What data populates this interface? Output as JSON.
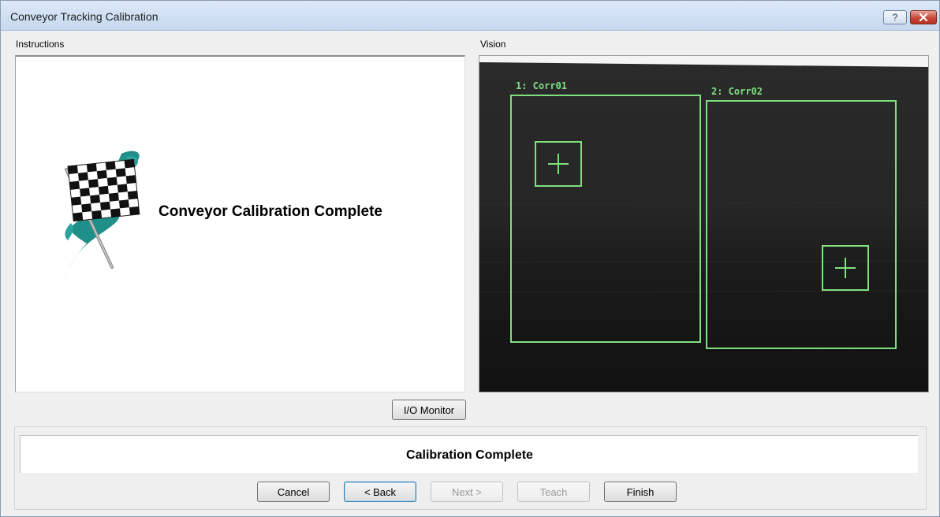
{
  "window": {
    "title": "Conveyor Tracking Calibration",
    "help_label": "?"
  },
  "instructions": {
    "group_label": "Instructions",
    "heading": "Conveyor Calibration Complete"
  },
  "vision": {
    "group_label": "Vision",
    "regions": [
      {
        "label": "1: Corr01"
      },
      {
        "label": "2: Corr02"
      }
    ],
    "overlay_color": "#7fe07f",
    "background_color": "#1f1f1f"
  },
  "io_monitor": {
    "label": "I/O Monitor"
  },
  "status": {
    "text": "Calibration Complete"
  },
  "buttons": {
    "cancel": "Cancel",
    "back": "< Back",
    "next": "Next >",
    "teach": "Teach",
    "finish": "Finish"
  },
  "icons": {
    "help": "help-icon",
    "close": "close-icon",
    "flag": "checkered-flag-icon"
  }
}
